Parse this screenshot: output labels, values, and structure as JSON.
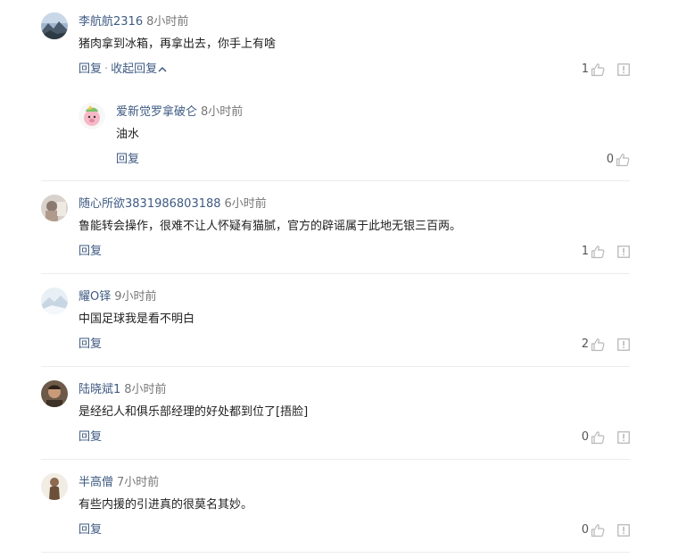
{
  "comments": [
    {
      "user": "李航航2316",
      "time": "8小时前",
      "text": "猪肉拿到冰箱，再拿出去，你手上有啥",
      "reply_label": "回复",
      "separator": "·",
      "collapse_label": "收起回复",
      "likes": "1",
      "avatar_icon": "mountain-landscape-avatar",
      "reply": {
        "user": "爱新觉罗拿破仑",
        "time": "8小时前",
        "text": "油水",
        "reply_label": "回复",
        "likes": "0",
        "avatar_icon": "cartoon-pig-avatar"
      }
    },
    {
      "user": "随心所欲3831986803188",
      "time": "6小时前",
      "text": "鲁能转会操作，很难不让人怀疑有猫腻，官方的辟谣属于此地无银三百两。",
      "reply_label": "回复",
      "likes": "1",
      "avatar_icon": "photo-avatar"
    },
    {
      "user": "耀O铎",
      "time": "9小时前",
      "text": "中国足球我是看不明白",
      "reply_label": "回复",
      "likes": "2",
      "avatar_icon": "snowy-landscape-avatar"
    },
    {
      "user": "陆晓斌1",
      "time": "8小时前",
      "text": "是经纪人和俱乐部经理的好处都到位了[捂脸]",
      "reply_label": "回复",
      "likes": "0",
      "avatar_icon": "person-photo-avatar"
    },
    {
      "user": "半高僧",
      "time": "7小时前",
      "text": "有些内援的引进真的很莫名其妙。",
      "reply_label": "回复",
      "likes": "0",
      "avatar_icon": "figure-photo-avatar"
    }
  ],
  "colors": {
    "username": "#3e5a82",
    "link": "#3e5a82",
    "time": "#777777",
    "text": "#222222",
    "icon": "#b8b8b8",
    "divider": "#ececec"
  }
}
